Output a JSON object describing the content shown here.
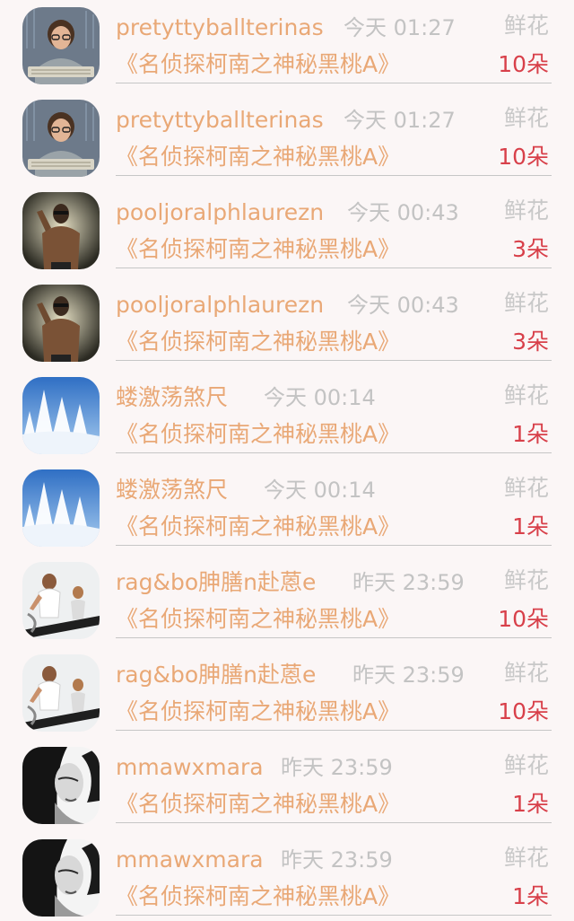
{
  "rows": [
    {
      "username": "pretyttyballterinas",
      "time": "今天 01:27",
      "gift_type": "鲜花",
      "book_title": "《名侦探柯南之神秘黑桃A》",
      "count": "10朵",
      "avatar": "boy-at-keyboard-avatar"
    },
    {
      "username": "pretyttyballterinas",
      "time": "今天 01:27",
      "gift_type": "鲜花",
      "book_title": "《名侦探柯南之神秘黑桃A》",
      "count": "10朵",
      "avatar": "boy-at-keyboard-avatar"
    },
    {
      "username": "pooljoralphlaurezn",
      "time": "今天 00:43",
      "gift_type": "鲜花",
      "book_title": "《名侦探柯南之神秘黑桃A》",
      "count": "3朵",
      "avatar": "shirtless-man-avatar"
    },
    {
      "username": "pooljoralphlaurezn",
      "time": "今天 00:43",
      "gift_type": "鲜花",
      "book_title": "《名侦探柯南之神秘黑桃A》",
      "count": "3朵",
      "avatar": "shirtless-man-avatar"
    },
    {
      "username": "蝼激荡煞尺",
      "time": "今天 00:14",
      "gift_type": "鲜花",
      "book_title": "《名侦探柯南之神秘黑桃A》",
      "count": "1朵",
      "avatar": "snowy-trees-avatar"
    },
    {
      "username": "蝼激荡煞尺",
      "time": "今天 00:14",
      "gift_type": "鲜花",
      "book_title": "《名侦探柯南之神秘黑桃A》",
      "count": "1朵",
      "avatar": "snowy-trees-avatar"
    },
    {
      "username": "rag&bo胂膳n赴蒽e",
      "time": "昨天 23:59",
      "gift_type": "鲜花",
      "book_title": "《名侦探柯南之神秘黑桃A》",
      "count": "10朵",
      "avatar": "treadmill-couple-avatar"
    },
    {
      "username": "rag&bo胂膳n赴蒽e",
      "time": "昨天 23:59",
      "gift_type": "鲜花",
      "book_title": "《名侦探柯南之神秘黑桃A》",
      "count": "10朵",
      "avatar": "treadmill-couple-avatar"
    },
    {
      "username": "mmawxmara",
      "time": "昨天 23:59",
      "gift_type": "鲜花",
      "book_title": "《名侦探柯南之神秘黑桃A》",
      "count": "1朵",
      "avatar": "woman-portrait-avatar"
    },
    {
      "username": "mmawxmara",
      "time": "昨天 23:59",
      "gift_type": "鲜花",
      "book_title": "《名侦探柯南之神秘黑桃A》",
      "count": "1朵",
      "avatar": "woman-portrait-avatar"
    }
  ],
  "colors": {
    "background": "#fbf6f6",
    "username": "#e9a876",
    "book_title": "#e9a876",
    "time": "#c3c3c3",
    "gift_type": "#c8c8c8",
    "count": "#d8404a",
    "divider": "#c6c6c6"
  }
}
